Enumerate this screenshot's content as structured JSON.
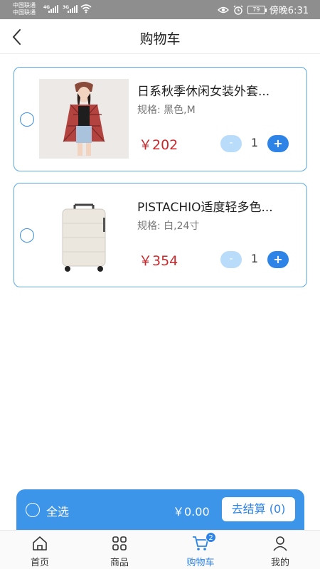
{
  "status_bar": {
    "carrier_1": "中国联通",
    "carrier_2": "中国联通",
    "net_1": "4G",
    "net_2": "3G",
    "battery": "79",
    "time": "傍晚6:31"
  },
  "header": {
    "title": "购物车",
    "back_icon": "chevron-left-icon"
  },
  "cart": {
    "items": [
      {
        "name": "日系秋季休闲女装外套...",
        "spec": "规格: 黑色,M",
        "price": "￥202",
        "minus": "-",
        "quantity": "1",
        "plus": "+",
        "image": "model-in-red-plaid-shirt"
      },
      {
        "name": "PISTACHIO适度轻多色...",
        "spec": "规格: 白,24寸",
        "price": "￥354",
        "minus": "-",
        "quantity": "1",
        "plus": "+",
        "image": "white-suitcase"
      }
    ]
  },
  "checkout": {
    "select_all_label": "全选",
    "total": "￥0.00",
    "button_label": "去结算 (0)"
  },
  "tabs": [
    {
      "label": "首页",
      "icon": "home-icon"
    },
    {
      "label": "商品",
      "icon": "grid-icon"
    },
    {
      "label": "购物车",
      "icon": "cart-icon",
      "badge": "2",
      "active": true
    },
    {
      "label": "我的",
      "icon": "user-icon"
    }
  ],
  "colors": {
    "accent": "#2d84e6",
    "price": "#c8292c",
    "status_bar": "#8e8e8e"
  }
}
